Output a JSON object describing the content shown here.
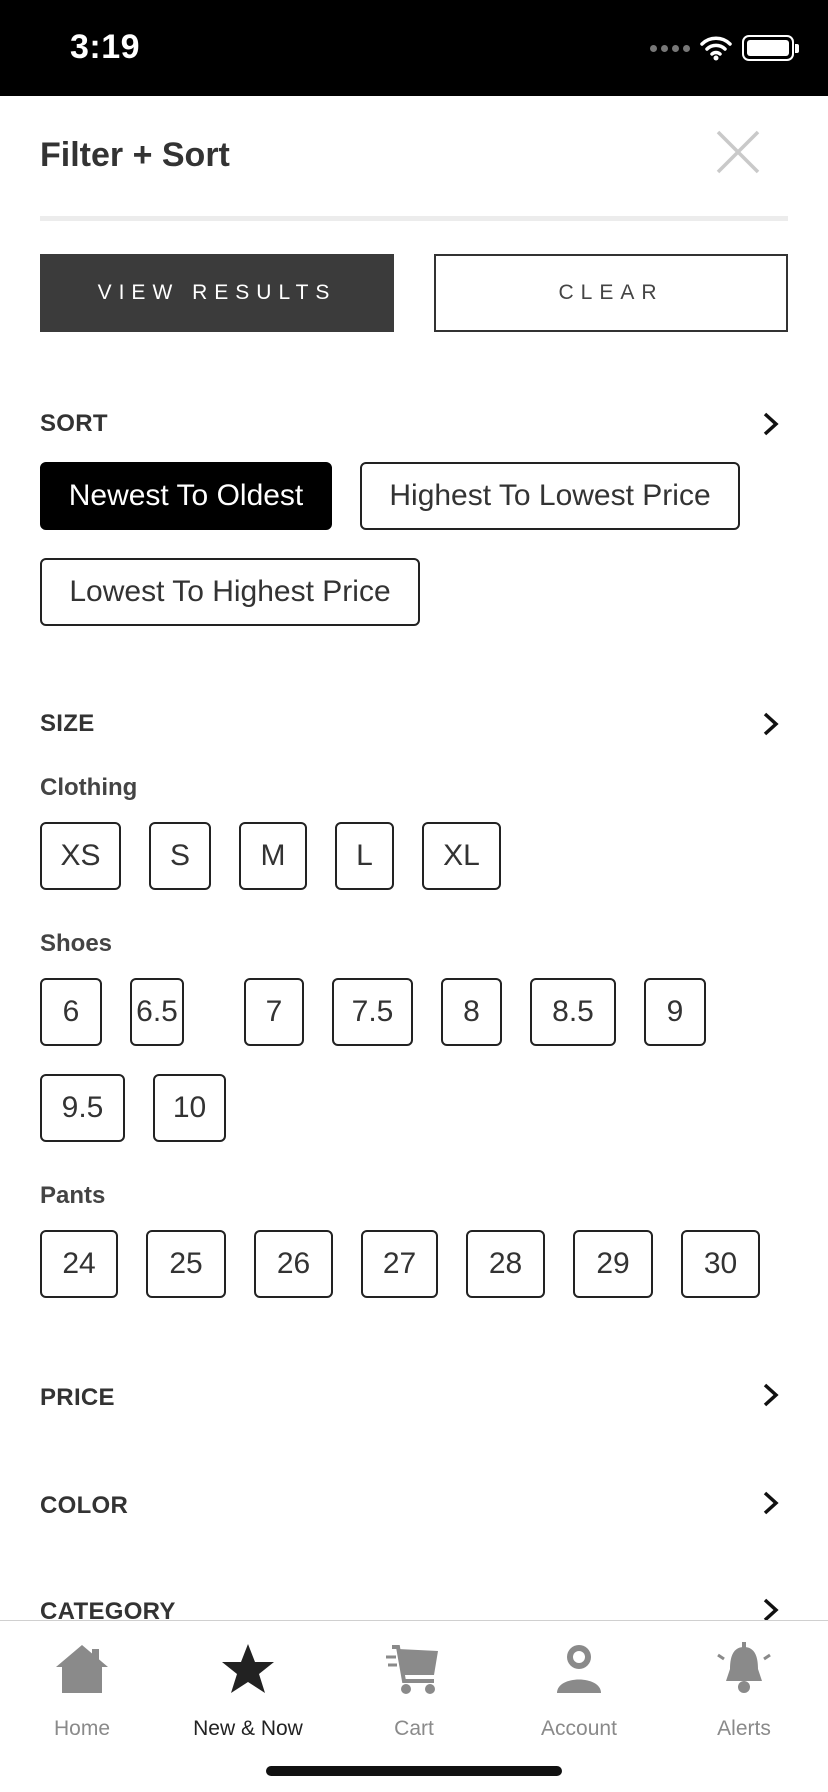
{
  "status_bar": {
    "time": "3:19"
  },
  "header": {
    "title": "Filter + Sort"
  },
  "actions": {
    "view_results": "VIEW RESULTS",
    "clear": "CLEAR"
  },
  "sort": {
    "title": "SORT",
    "options": [
      "Newest To Oldest",
      "Highest To Lowest Price",
      "Lowest To Highest Price"
    ],
    "selected": "Newest To Oldest"
  },
  "size": {
    "title": "SIZE",
    "clothing": {
      "label": "Clothing",
      "options": [
        "XS",
        "S",
        "M",
        "L",
        "XL"
      ]
    },
    "shoes": {
      "label": "Shoes",
      "options": [
        "6",
        "6.5",
        "7",
        "7.5",
        "8",
        "8.5",
        "9",
        "9.5",
        "10"
      ]
    },
    "pants": {
      "label": "Pants",
      "options": [
        "24",
        "25",
        "26",
        "27",
        "28",
        "29",
        "30"
      ]
    }
  },
  "price": {
    "title": "PRICE"
  },
  "color": {
    "title": "COLOR"
  },
  "category": {
    "title": "CATEGORY"
  },
  "tab_bar": {
    "tabs": [
      {
        "label": "Home",
        "icon": "home-icon"
      },
      {
        "label": "New & Now",
        "icon": "star-icon",
        "active": true
      },
      {
        "label": "Cart",
        "icon": "cart-icon"
      },
      {
        "label": "Account",
        "icon": "account-icon"
      },
      {
        "label": "Alerts",
        "icon": "bell-icon"
      }
    ]
  },
  "colors": {
    "selected_chip": "#000000",
    "primary_button": "#3b3b3b",
    "inactive_tab": "#8a8a8a"
  }
}
